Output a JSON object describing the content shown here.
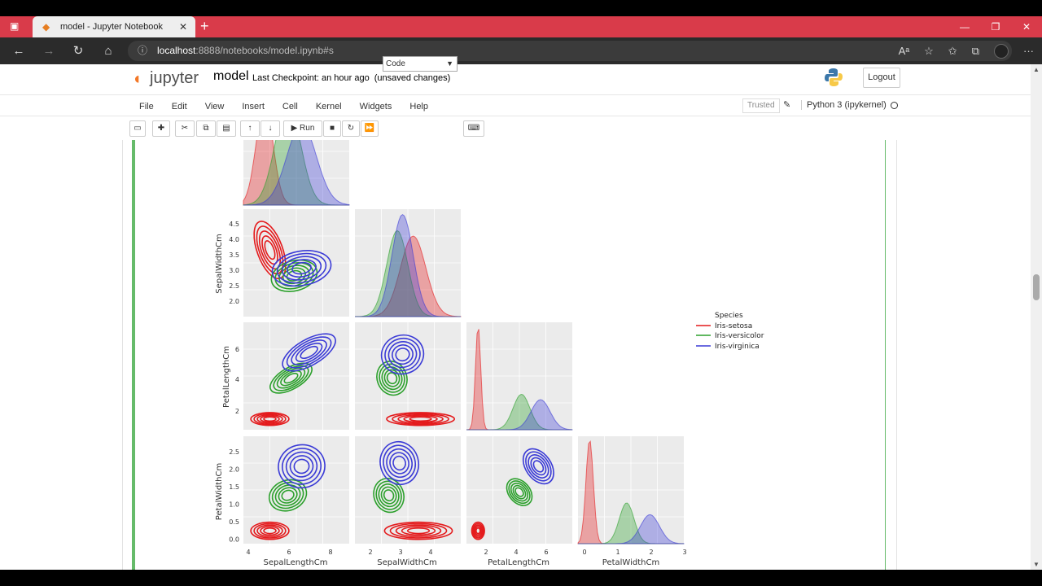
{
  "browser": {
    "tab_title": "model - Jupyter Notebook",
    "new_tab": "+",
    "tab_close": "✕",
    "url_host": "localhost",
    "url_path": ":8888/notebooks/model.ipynb#s",
    "win_min": "—",
    "win_max": "❐",
    "win_close": "✕"
  },
  "jupyter": {
    "logo_text": "jupyter",
    "notebook_name": "model",
    "checkpoint": "Last Checkpoint: an hour ago",
    "unsaved": "(unsaved changes)",
    "logout": "Logout",
    "menu": [
      "File",
      "Edit",
      "View",
      "Insert",
      "Cell",
      "Kernel",
      "Widgets",
      "Help"
    ],
    "trusted": "Trusted",
    "kernel_name": "Python 3 (ipykernel)",
    "run_label": "Run",
    "cell_type": "Code"
  },
  "chart_data": {
    "type": "pairplot",
    "variables": [
      "SepalLengthCm",
      "SepalWidthCm",
      "PetalLengthCm",
      "PetalWidthCm"
    ],
    "legend_title": "Species",
    "species": [
      {
        "name": "Iris-setosa",
        "color": "#e41a1c",
        "sepal_length_mean": 5.0,
        "sepal_width_mean": 3.4,
        "petal_length_mean": 1.5,
        "petal_width_mean": 0.25
      },
      {
        "name": "Iris-versicolor",
        "color": "#2ca02c",
        "sepal_length_mean": 5.9,
        "sepal_width_mean": 2.8,
        "petal_length_mean": 4.3,
        "petal_width_mean": 1.3
      },
      {
        "name": "Iris-virginica",
        "color": "#3b3bd6",
        "sepal_length_mean": 6.6,
        "sepal_width_mean": 3.0,
        "petal_length_mean": 5.5,
        "petal_width_mean": 2.0
      }
    ],
    "ylabels": [
      "SepalWidthCm",
      "PetalLengthCm",
      "PetalWidthCm"
    ],
    "xlabels": [
      "SepalLengthCm",
      "SepalWidthCm",
      "PetalLengthCm",
      "PetalWidthCm"
    ],
    "sepal_width_ticks": [
      "4.5",
      "4.0",
      "3.5",
      "3.0",
      "2.5",
      "2.0"
    ],
    "petal_length_ticks": [
      "6",
      "4",
      "2"
    ],
    "petal_width_ticks": [
      "2.5",
      "2.0",
      "1.5",
      "1.0",
      "0.5",
      "0.0"
    ],
    "x1_ticks": [
      "4",
      "6",
      "8"
    ],
    "x2_ticks": [
      "2",
      "3",
      "4"
    ],
    "x3_ticks": [
      "2",
      "4",
      "6"
    ],
    "x4_ticks": [
      "0",
      "1",
      "2",
      "3"
    ],
    "grid": true,
    "legend_placement": "right"
  }
}
